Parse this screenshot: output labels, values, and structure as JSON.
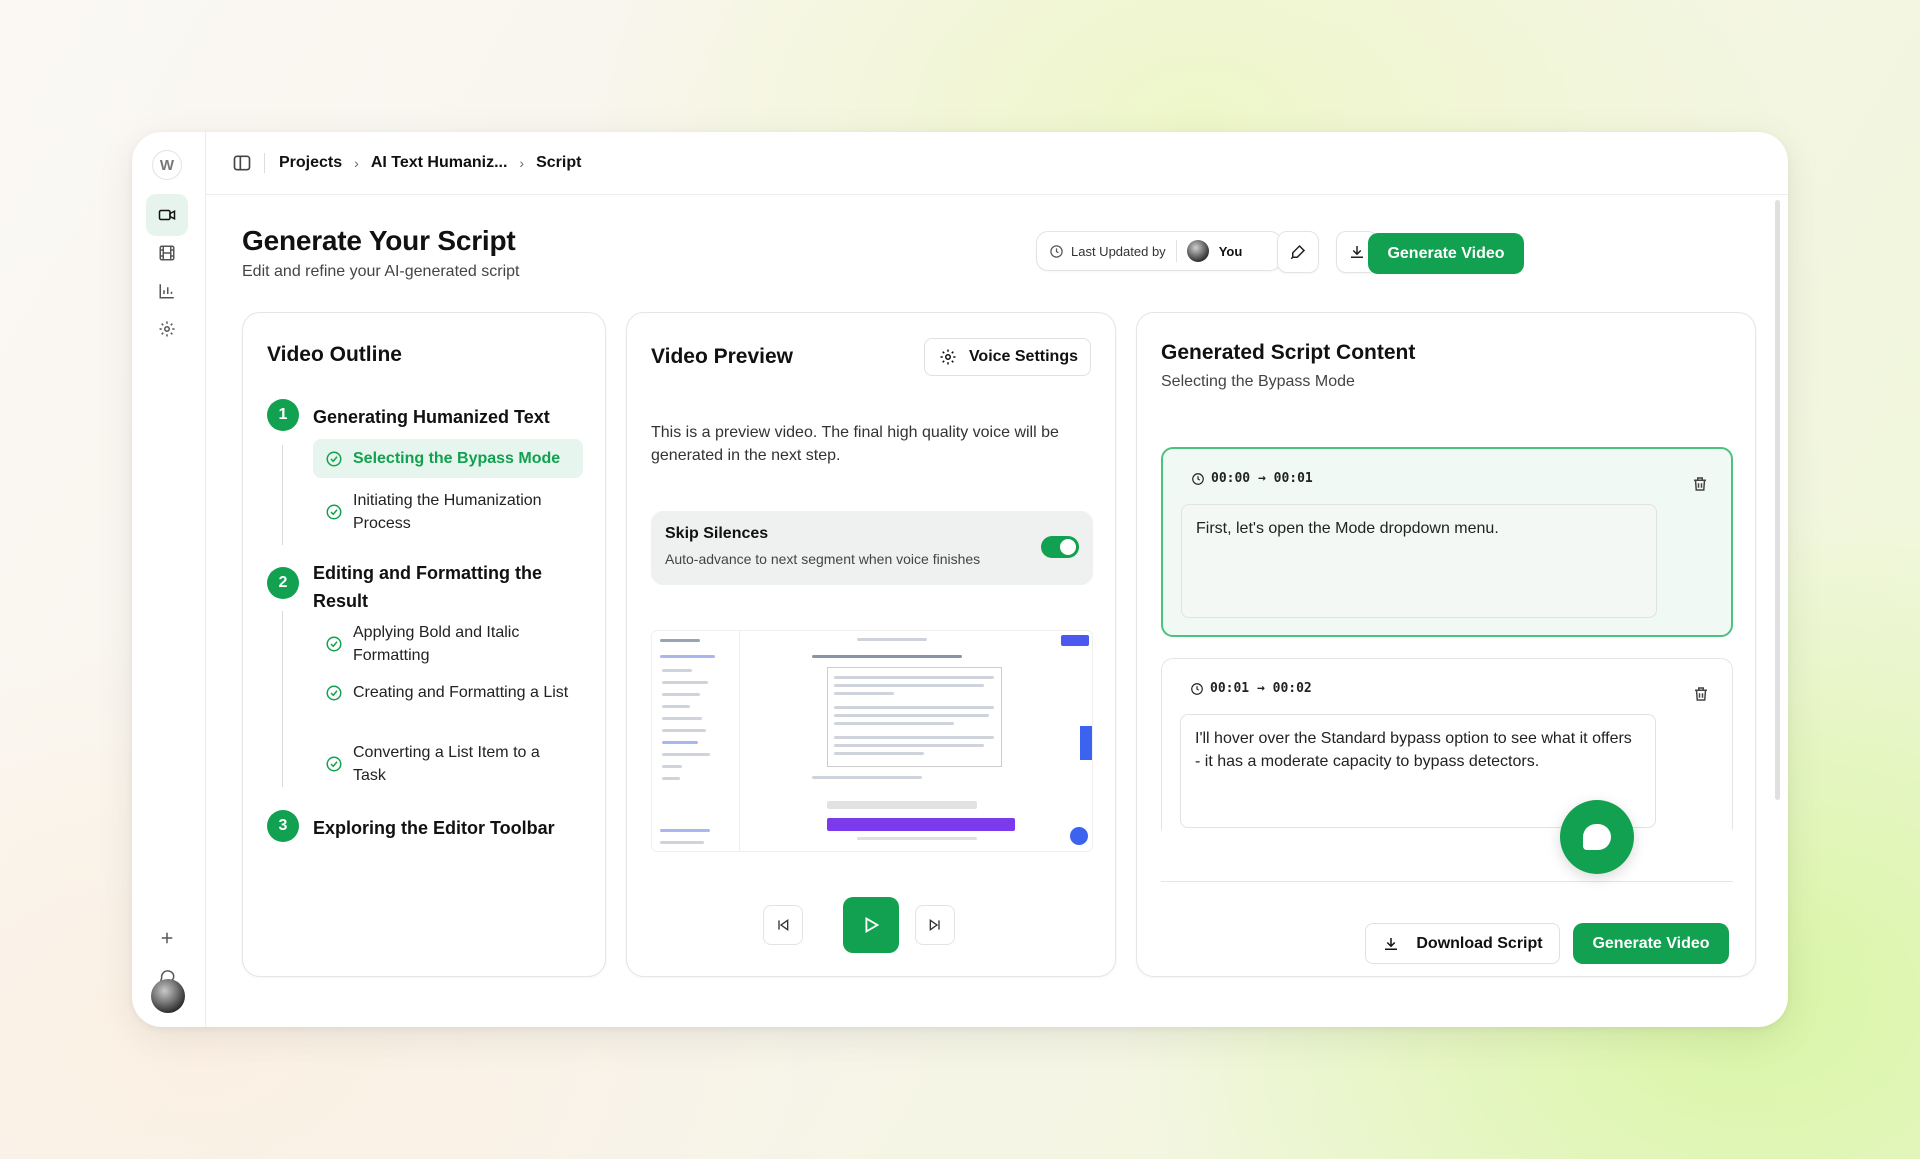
{
  "rail": {
    "logo": "W",
    "items": [
      "video-icon",
      "film-icon",
      "chart-icon",
      "settings-icon"
    ],
    "bottom": [
      "plus-icon",
      "chat-icon"
    ]
  },
  "breadcrumb": {
    "items": [
      "Projects",
      "AI Text Humaniz...",
      "Script"
    ]
  },
  "header": {
    "title": "Generate Your Script",
    "subtitle": "Edit and refine your AI-generated script",
    "last_updated_label": "Last Updated by",
    "last_updated_user": "You",
    "generate_label": "Generate Video"
  },
  "outline": {
    "title": "Video Outline",
    "sections": [
      {
        "number": "1",
        "title": "Generating Humanized Text",
        "items": [
          "Selecting the Bypass Mode",
          "Initiating the Humanization Process"
        ]
      },
      {
        "number": "2",
        "title": "Editing and Formatting the Result",
        "items": [
          "Applying Bold and Italic Formatting",
          "Creating and Formatting a List",
          "Converting a List Item to a Task"
        ]
      },
      {
        "number": "3",
        "title": "Exploring the Editor Toolbar",
        "items": []
      }
    ],
    "active_item": "Selecting the Bypass Mode"
  },
  "preview": {
    "title": "Video Preview",
    "voice_settings_label": "Voice Settings",
    "note": "This is a preview video. The final high quality voice will be generated in the next step.",
    "skip_title": "Skip Silences",
    "skip_sub": "Auto-advance to next segment when voice finishes",
    "skip_enabled": true
  },
  "script": {
    "title": "Generated Script Content",
    "subtitle": "Selecting the Bypass Mode",
    "segments": [
      {
        "time": "00:00 → 00:01",
        "text": "First, let's open the Mode dropdown menu.",
        "active": true
      },
      {
        "time": "00:01 → 00:02",
        "text": "I'll hover over the Standard bypass option to see what it offers - it has a moderate capacity to bypass detectors.",
        "active": false
      }
    ],
    "download_label": "Download Script",
    "generate_label": "Generate Video"
  },
  "colors": {
    "accent": "#12a150",
    "active_bg": "#e6f5ed"
  }
}
